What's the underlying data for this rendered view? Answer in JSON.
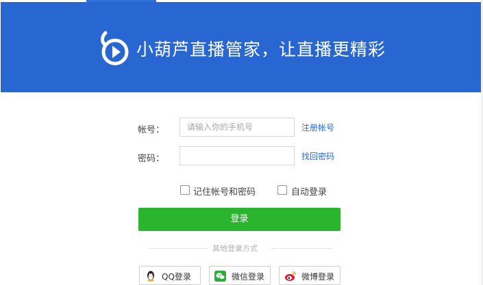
{
  "banner": {
    "slogan": "小葫芦直播管家，让直播更精彩",
    "brand_color": "#2866d1"
  },
  "form": {
    "account_label": "帐号：",
    "account_placeholder": "请输入你的手机号",
    "account_value": "",
    "register_link": "注册帐号",
    "password_label": "密码：",
    "password_value": "",
    "forgot_link": "找回密码",
    "remember_label": "记住帐号和密码",
    "remember_checked": false,
    "autologin_label": "自动登录",
    "autologin_checked": false,
    "login_button": "登录",
    "login_color": "#2bb52f"
  },
  "other_login": {
    "title": "其他登录方式",
    "buttons": [
      {
        "label": "QQ登录",
        "icon": "qq-penguin-icon"
      },
      {
        "label": "微信登录",
        "icon": "wechat-icon"
      },
      {
        "label": "微博登录",
        "icon": "weibo-icon"
      }
    ]
  }
}
